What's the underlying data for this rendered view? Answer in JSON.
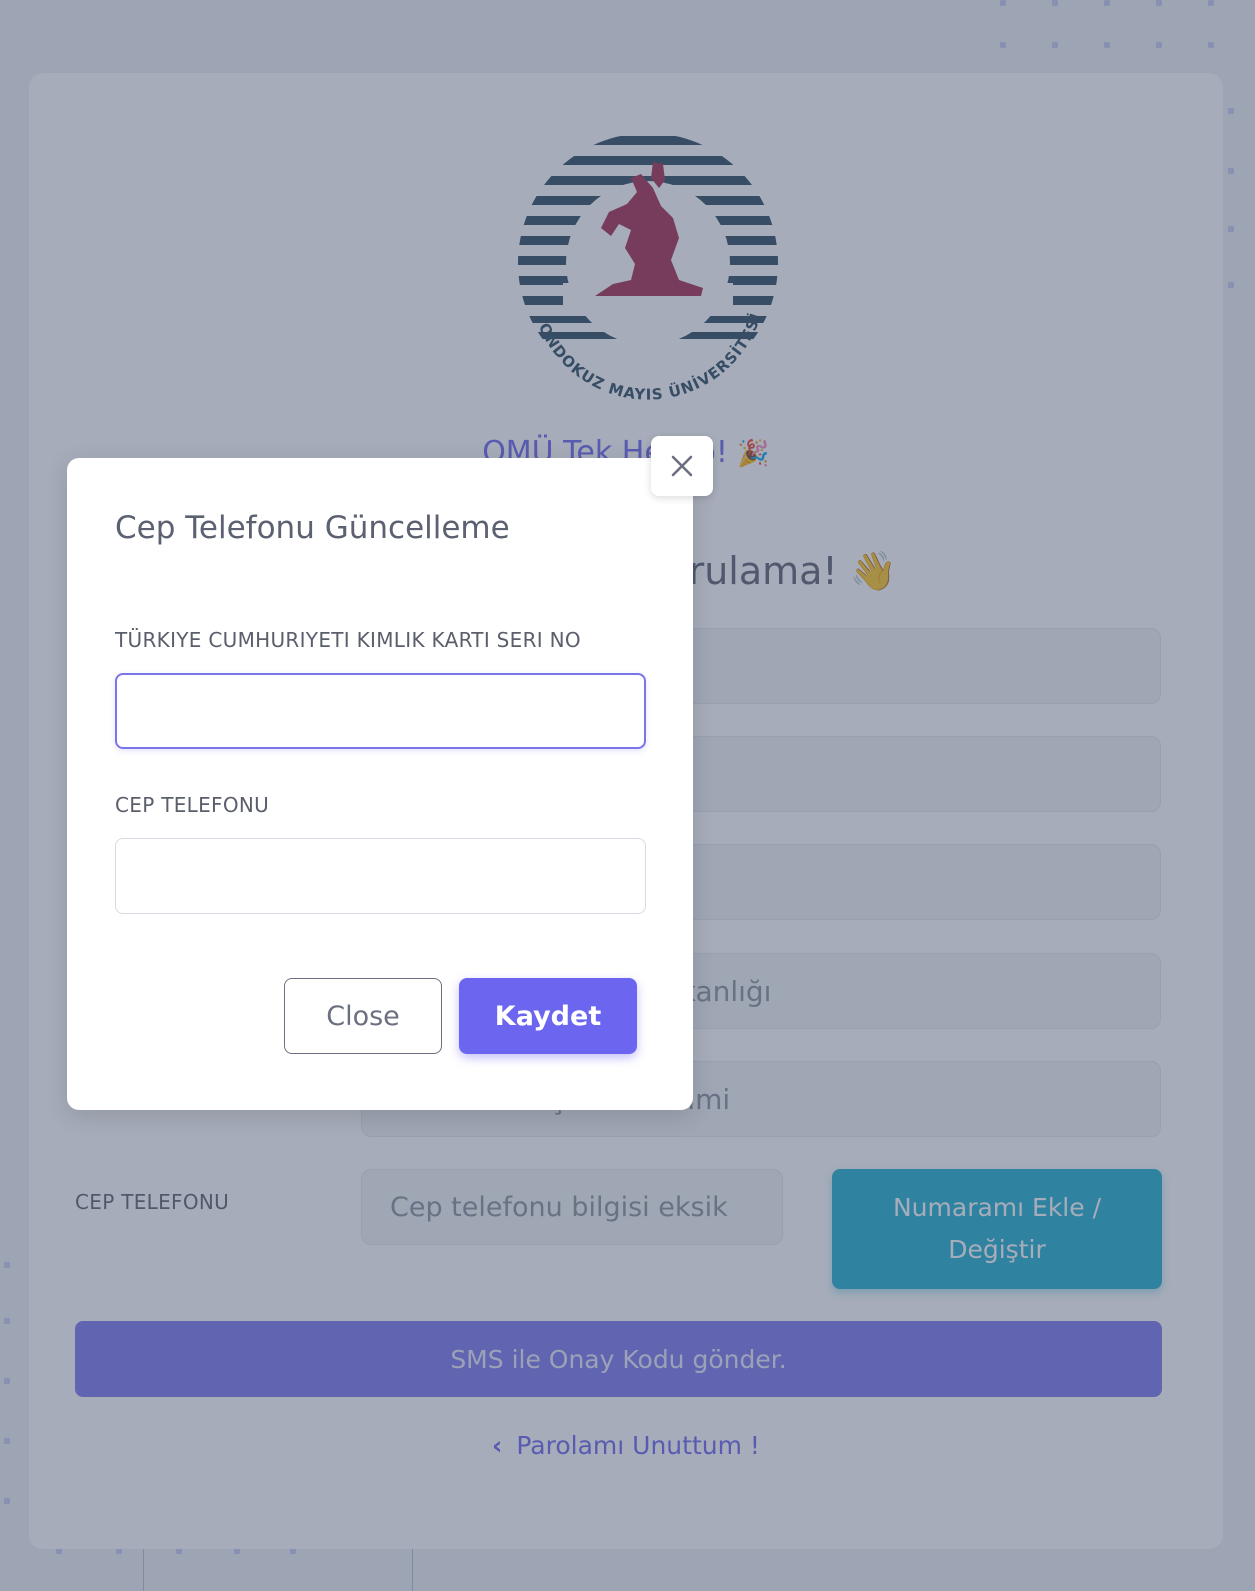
{
  "brand": {
    "logo_text": "ONDOKUZ MAYIS ÜNİVERSİTESİ",
    "welcome_text": "OMÜ Tek Hesap!",
    "welcome_emoji": "🎉",
    "subtitle": "Cep Telefonu Doğrulama!",
    "subtitle_emoji": "👋"
  },
  "background_form": {
    "fields": [
      {
        "value": ""
      },
      {
        "value": ""
      },
      {
        "value": ""
      },
      {
        "value": "Bilgi İşlem Daire Başkanlığı"
      },
      {
        "value": "Yazılım Geliştirme Birimi"
      }
    ],
    "phone_label": "CEP TELEFONU",
    "phone_placeholder": "Cep telefonu bilgisi eksik",
    "number_button_line1": "Numaramı Ekle /",
    "number_button_line2": "Değiştir",
    "sms_button": "SMS ile Onay Kodu gönder.",
    "forgot_link": "Parolamı Unuttum !",
    "forgot_icon": "chevron-left-icon"
  },
  "modal": {
    "title": "Cep Telefonu Güncelleme",
    "id_serial_label": "TÜRKIYE CUMHURIYETI KIMLIK KARTI SERI NO",
    "id_serial_value": "",
    "phone_label": "CEP TELEFONU",
    "phone_value": "",
    "close_button": "Close",
    "save_button": "Kaydet",
    "close_icon": "close-icon"
  },
  "colors": {
    "primary": "#6c65f0",
    "info": "#1bb1cf",
    "overlay": "rgba(68,82,108,0.48)",
    "logo_red": "#a52a4d",
    "logo_navy": "#2a4a5e"
  }
}
